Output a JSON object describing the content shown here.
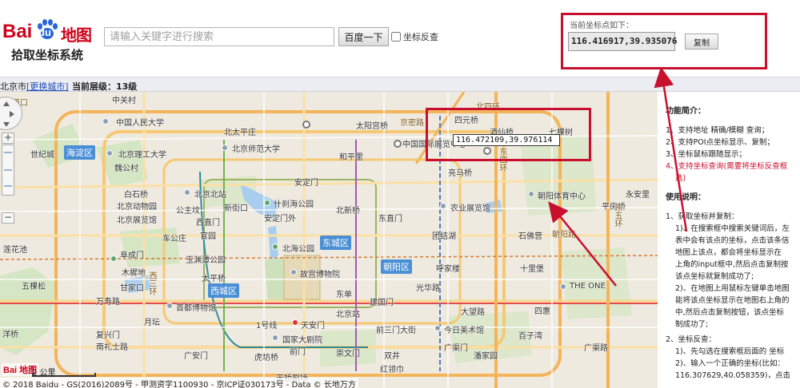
{
  "header": {
    "logo_bai": "Bai",
    "logo_du": "du",
    "logo_ditu": "地图",
    "subtitle": "拾取坐标系统",
    "search_placeholder": "请输入关键字进行搜索",
    "search_button": "百度一下",
    "reverse_label": "坐标反查"
  },
  "coord_panel": {
    "label": "当前坐标点如下：",
    "value": "116.416917,39.935076",
    "copy_button": "复制"
  },
  "statusbar": {
    "city": "北京市",
    "change_city": "[更换城市]",
    "level": "当前层级：13级"
  },
  "map": {
    "tooltip": "116.472109,39.976114",
    "districts": [
      "海淀区",
      "东城区",
      "西城区",
      "朝阳区"
    ],
    "labels": {
      "zhongguancun": "中关村",
      "renmin_univ": "中国人民大学",
      "beitaipingzhuang": "北太平庄",
      "beishida": "北京师范大学",
      "taiping": "太阳宫桥",
      "siyuanqiao": "四元桥",
      "jiuxianqiao": "酒仙桥",
      "qikeshu": "七棵树",
      "shijicheng": "世纪城",
      "ligong": "北京理工大学",
      "weigongcun": "魏公村",
      "hepingli": "和平里",
      "china_expo": "中国国际展览中心",
      "anding": "安定门",
      "liangma": "亮马桥",
      "baishiqiao": "白石桥",
      "beijingzhan_n": "北京北站",
      "dongzhimen": "东直门",
      "chaoyang_sports": "朝阳体育中心",
      "yongan": "永安里",
      "zoo": "北京动物园",
      "zhanlan": "北京展览馆",
      "xinjiekou": "新街口",
      "shichahai": "什刹海公园",
      "beixinqiao": "北新桥",
      "nongye": "农业展览馆",
      "pingfang": "平房桥",
      "gongzhufen": "公主坟",
      "fuchengmen": "阜成门",
      "beihai": "北海公园",
      "tuanjiehu": "团结湖",
      "shifoying": "石佛营",
      "yuyuantan": "玉渊潭公园",
      "guanyuan": "官园",
      "palace": "故宫博物院",
      "hujialou": "呼家楼",
      "shilipu": "十里堡",
      "muxidi": "木樨地",
      "capital_museum": "首都博物馆",
      "tiananmen": "天安门",
      "dongdan": "东单",
      "guomao": "光华路",
      "theone": "THE ONE",
      "line1": "1号线",
      "national_theater": "国家大剧院",
      "jianguomen": "建国门",
      "dawang": "大望路",
      "sihui": "四惠",
      "guang_anmen": "广安门",
      "qianmen": "前门",
      "chongwenmen": "崇文门",
      "today_art": "今日美术馆",
      "baiziwan": "百子湾",
      "guangqu": "广渠门",
      "guangqu_road": "广渠路",
      "shuangjing": "双井",
      "huguo": "虎坊桥",
      "tianqiao": "天桥剧场",
      "honglou": "红领巾",
      "panjiayuan": "潘家园",
      "wukesong": "五棵松",
      "wanshou": "万寿路",
      "donsihuan": "东四环",
      "dongwuhuan": "东五环",
      "xi_ring": "西三环",
      "wudaokou": "五道口",
      "beisihuan": "北四环",
      "jingmi": "京密路",
      "chaoyanglu": "朝阳路",
      "fuxingmen": "复兴门",
      "nanlishi": "南礼士路",
      "lianhuachi": "莲花池",
      "yangqiao": "洋桥",
      "andingmenwai": "安定门外",
      "beijing_station": "北京站",
      "qiansanmen": "前三门大街",
      "taipingqiao": "太平桥",
      "chegongzhuang": "车公庄",
      "xizhimen": "西直门",
      "ganjiakou": "甘家口",
      "yuetan": "月坛"
    },
    "map_logo": "Bai 地图",
    "scale": "2 公里",
    "copyright": "© 2018 Baidu - GS(2016)2089号 - 甲测资字1100930 - 京ICP证030173号 - Data © 长地万方"
  },
  "info": {
    "heading1": "功能简介：",
    "f1": "1、支持地址 精确/模糊 查询；",
    "f2": "2、支持POI点坐标显示、复制；",
    "f3": "3、坐标鼠标跟随显示；",
    "f4": "4、支持坐标查询(需要将坐标反查框",
    "f4b": "选)",
    "heading2": "使用说明：",
    "u1": "1、获取坐标并复制：",
    "u1a": "1)、在搜索框中搜索关键词后，左",
    "u1b": "表中会有该点的坐标，点击该条信",
    "u1c": "地图上该点，都会将坐标显示在",
    "u1d": "上角的input框中,然后点击复制按",
    "u1e": "该点坐标就复制成功了;",
    "u1f": "2)、在地图上用鼠标左键单击地图",
    "u1g": "能将该点坐标显示在地图右上角的",
    "u1h": "中,然后点击复制按钮，该点坐标",
    "u1i": "制成功了;",
    "u2": "2、坐标反查：",
    "u2a": "1)、先勾选在搜索框后面的 坐标",
    "u2b": "2)、输入一个正确的坐标(比如：",
    "u2c": "116.307629,40.058359)，点击"
  }
}
